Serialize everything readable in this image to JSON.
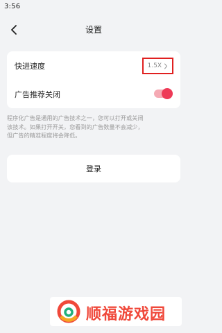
{
  "status_bar": {
    "time": "3:56"
  },
  "header": {
    "title": "设置",
    "back_icon": "chevron-left-icon"
  },
  "settings": {
    "playback_speed": {
      "label": "快进速度",
      "value": "1.5X",
      "icon": "chevron-right-icon"
    },
    "ad_recommendation": {
      "label": "广告推荐关闭",
      "toggle_on": true,
      "toggle_color": "#ee3a57"
    }
  },
  "hint": {
    "lines": [
      "程序化广告是通用的广告技术之一，您可以打开或关闭",
      "该技术。如果打开开关，您看到的广告数量不会减少，",
      "但广告的精准程度将会降低。"
    ]
  },
  "login": {
    "label": "登录"
  },
  "watermark": {
    "text": "顺福游戏园"
  },
  "colors": {
    "highlight_box": "#e02020",
    "background": "#f2f3f5",
    "brand": "#f0483a"
  }
}
